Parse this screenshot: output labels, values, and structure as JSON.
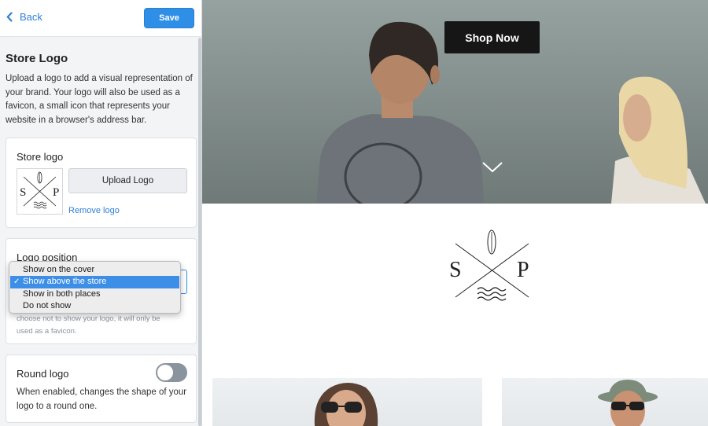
{
  "topbar": {
    "back_label": "Back",
    "save_label": "Save"
  },
  "section": {
    "title": "Store Logo",
    "description": "Upload a logo to add a visual representation of your brand. Your logo will also be used as a favicon, a small icon that represents your website in a browser's address bar."
  },
  "store_logo_card": {
    "title": "Store logo",
    "upload_label": "Upload Logo",
    "remove_label": "Remove logo",
    "logo_letters": {
      "left": "S",
      "right": "P"
    }
  },
  "logo_position_card": {
    "title": "Logo position",
    "options": [
      "Show on the cover",
      "Show above the store",
      "Show in both places",
      "Do not show"
    ],
    "selected": "Show above the store",
    "help_line1": "choose not to show your logo, it will only be",
    "help_line2": "used as a favicon."
  },
  "round_logo_card": {
    "title": "Round logo",
    "enabled": false,
    "description": "When enabled, changes the shape of your logo to a round one."
  },
  "preview": {
    "shop_now_label": "Shop Now",
    "logo_letters": {
      "left": "S",
      "right": "P"
    }
  },
  "colors": {
    "accent": "#2f8fe6",
    "link": "#2f80d8",
    "selected_option": "#3d8ee6",
    "shop_button": "#161616"
  }
}
